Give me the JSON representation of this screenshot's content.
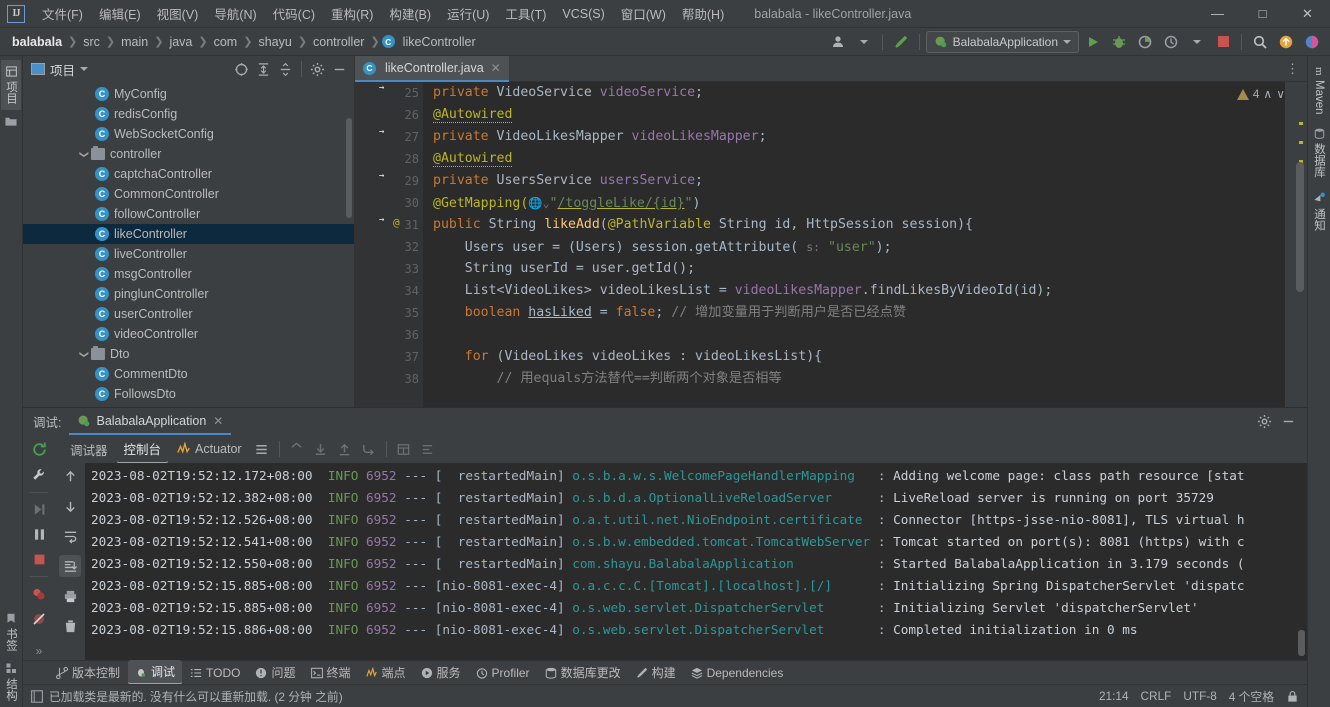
{
  "window": {
    "title": "balabala - likeController.java",
    "minimize_label": "—",
    "maximize_label": "□",
    "close_label": "✕"
  },
  "menu": [
    {
      "label": "文件(F)"
    },
    {
      "label": "编辑(E)"
    },
    {
      "label": "视图(V)"
    },
    {
      "label": "导航(N)"
    },
    {
      "label": "代码(C)"
    },
    {
      "label": "重构(R)"
    },
    {
      "label": "构建(B)"
    },
    {
      "label": "运行(U)"
    },
    {
      "label": "工具(T)"
    },
    {
      "label": "VCS(S)"
    },
    {
      "label": "窗口(W)"
    },
    {
      "label": "帮助(H)"
    }
  ],
  "breadcrumb": {
    "root": "balabala",
    "items": [
      "src",
      "main",
      "java",
      "com",
      "shayu",
      "controller"
    ],
    "file": "likeController",
    "file_icon": "C"
  },
  "toolbar": {
    "run_config": "BalabalaApplication",
    "run_label": "run-icon",
    "debug_label": "debug-icon",
    "stop_label": "stop-icon",
    "search_label": "search-icon"
  },
  "left_rail": [
    {
      "label": "项目",
      "icon": "project-icon",
      "active": true
    },
    {
      "label": "书签",
      "icon": "bookmark-icon",
      "active": false
    },
    {
      "label": "结构",
      "icon": "structure-icon",
      "active": false
    }
  ],
  "right_rail": [
    {
      "label": "Maven",
      "icon": "maven-icon"
    },
    {
      "label": "数据库",
      "icon": "database-icon"
    },
    {
      "label": "通知",
      "icon": "notification-icon"
    }
  ],
  "project_panel": {
    "title": "项目",
    "tree": [
      {
        "label": "MyConfig",
        "type": "class",
        "indent": 4,
        "selected": false
      },
      {
        "label": "redisConfig",
        "type": "class",
        "indent": 4,
        "selected": false
      },
      {
        "label": "WebSocketConfig",
        "type": "class",
        "indent": 4,
        "selected": false
      },
      {
        "label": "controller",
        "type": "package",
        "indent": 3,
        "selected": false,
        "expanded": true
      },
      {
        "label": "captchaController",
        "type": "class",
        "indent": 4,
        "selected": false
      },
      {
        "label": "CommonController",
        "type": "class",
        "indent": 4,
        "selected": false
      },
      {
        "label": "followController",
        "type": "class",
        "indent": 4,
        "selected": false
      },
      {
        "label": "likeController",
        "type": "class",
        "indent": 4,
        "selected": true
      },
      {
        "label": "liveController",
        "type": "class",
        "indent": 4,
        "selected": false
      },
      {
        "label": "msgController",
        "type": "class",
        "indent": 4,
        "selected": false
      },
      {
        "label": "pinglunController",
        "type": "class",
        "indent": 4,
        "selected": false
      },
      {
        "label": "userController",
        "type": "class",
        "indent": 4,
        "selected": false
      },
      {
        "label": "videoController",
        "type": "class",
        "indent": 4,
        "selected": false
      },
      {
        "label": "Dto",
        "type": "package",
        "indent": 3,
        "selected": false,
        "expanded": true
      },
      {
        "label": "CommentDto",
        "type": "class",
        "indent": 4,
        "selected": false
      },
      {
        "label": "FollowsDto",
        "type": "class",
        "indent": 4,
        "selected": false
      }
    ]
  },
  "editor": {
    "tab": {
      "label": "likeController.java",
      "icon": "C",
      "close": "✕"
    },
    "warning_count": "4",
    "lines": [
      {
        "n": "25",
        "marker": "bean"
      },
      {
        "n": "26",
        "marker": ""
      },
      {
        "n": "27",
        "marker": "bean"
      },
      {
        "n": "28",
        "marker": ""
      },
      {
        "n": "29",
        "marker": "bean"
      },
      {
        "n": "30",
        "marker": ""
      },
      {
        "n": "31",
        "marker": "bean-at",
        "fold": true
      },
      {
        "n": "32",
        "marker": ""
      },
      {
        "n": "33",
        "marker": ""
      },
      {
        "n": "34",
        "marker": ""
      },
      {
        "n": "35",
        "marker": ""
      },
      {
        "n": "36",
        "marker": ""
      },
      {
        "n": "37",
        "marker": "",
        "fold": true
      },
      {
        "n": "38",
        "marker": ""
      }
    ],
    "code": {
      "l25": "private VideoService videoService;",
      "l26": "@Autowired",
      "l27": "private VideoLikesMapper videoLikesMapper;",
      "l28": "@Autowired",
      "l29": "private UsersService usersService;",
      "l30_head": "@GetMapping(",
      "l30_path": "/toggleLike/{id}",
      "l31": "public String likeAdd(@PathVariable String id, HttpSession session){",
      "l32_a": "Users user = (Users) session.getAttribute(",
      "l32_hint": "s:",
      "l32_str": "\"user\"",
      "l32_b": ");",
      "l33": "String userId = user.getId();",
      "l34": "List<VideoLikes> videoLikesList = videoLikesMapper.findLikesByVideoId(id);",
      "l35_a": "boolean hasLiked = false; ",
      "l35_cmt": "// 增加变量用于判断用户是否已经点赞",
      "l37": "for (VideoLikes videoLikes : videoLikesList){",
      "l38_cmt": "// 用equals方法替代==判断两个对象是否相等"
    }
  },
  "debug_panel": {
    "label": "调试:",
    "session_tab": "BalabalaApplication",
    "session_close": "✕",
    "tabs": [
      {
        "label": "调试器",
        "active": false
      },
      {
        "label": "控制台",
        "active": true
      },
      {
        "label": "Actuator",
        "active": false,
        "icon": "actuator-icon"
      }
    ],
    "logs": [
      {
        "ts": "2023-08-02T19:52:12.172+08:00",
        "level": "INFO",
        "pid": "6952",
        "thread": "  restartedMain",
        "logger": "o.s.b.a.w.s.WelcomePageHandlerMapping",
        "msg": "Adding welcome page: class path resource [stat"
      },
      {
        "ts": "2023-08-02T19:52:12.382+08:00",
        "level": "INFO",
        "pid": "6952",
        "thread": "  restartedMain",
        "logger": "o.s.b.d.a.OptionalLiveReloadServer",
        "msg": "LiveReload server is running on port 35729"
      },
      {
        "ts": "2023-08-02T19:52:12.526+08:00",
        "level": "INFO",
        "pid": "6952",
        "thread": "  restartedMain",
        "logger": "o.a.t.util.net.NioEndpoint.certificate",
        "msg": "Connector [https-jsse-nio-8081], TLS virtual h"
      },
      {
        "ts": "2023-08-02T19:52:12.541+08:00",
        "level": "INFO",
        "pid": "6952",
        "thread": "  restartedMain",
        "logger": "o.s.b.w.embedded.tomcat.TomcatWebServer",
        "msg": "Tomcat started on port(s): 8081 (https) with c"
      },
      {
        "ts": "2023-08-02T19:52:12.550+08:00",
        "level": "INFO",
        "pid": "6952",
        "thread": "  restartedMain",
        "logger": "com.shayu.BalabalaApplication",
        "msg": "Started BalabalaApplication in 3.179 seconds ("
      },
      {
        "ts": "2023-08-02T19:52:15.885+08:00",
        "level": "INFO",
        "pid": "6952",
        "thread": "nio-8081-exec-4",
        "logger": "o.a.c.c.C.[Tomcat].[localhost].[/]",
        "msg": "Initializing Spring DispatcherServlet 'dispatc"
      },
      {
        "ts": "2023-08-02T19:52:15.885+08:00",
        "level": "INFO",
        "pid": "6952",
        "thread": "nio-8081-exec-4",
        "logger": "o.s.web.servlet.DispatcherServlet",
        "msg": "Initializing Servlet 'dispatcherServlet'"
      },
      {
        "ts": "2023-08-02T19:52:15.886+08:00",
        "level": "INFO",
        "pid": "6952",
        "thread": "nio-8081-exec-4",
        "logger": "o.s.web.servlet.DispatcherServlet",
        "msg": "Completed initialization in 0 ms"
      }
    ]
  },
  "tool_windows": [
    {
      "label": "版本控制",
      "icon": "vcs-icon",
      "active": false
    },
    {
      "label": "调试",
      "icon": "debug-icon",
      "active": true
    },
    {
      "label": "TODO",
      "icon": "todo-icon",
      "active": false
    },
    {
      "label": "问题",
      "icon": "problems-icon",
      "active": false
    },
    {
      "label": "终端",
      "icon": "terminal-icon",
      "active": false
    },
    {
      "label": "端点",
      "icon": "endpoints-icon",
      "active": false
    },
    {
      "label": "服务",
      "icon": "services-icon",
      "active": false
    },
    {
      "label": "Profiler",
      "icon": "profiler-icon",
      "active": false
    },
    {
      "label": "数据库更改",
      "icon": "db-changes-icon",
      "active": false
    },
    {
      "label": "构建",
      "icon": "build-icon",
      "active": false
    },
    {
      "label": "Dependencies",
      "icon": "dependencies-icon",
      "active": false
    }
  ],
  "status_bar": {
    "message": "已加载类是最新的. 没有什么可以重新加载. (2 分钟 之前)",
    "position": "21:14",
    "line_sep": "CRLF",
    "encoding": "UTF-8",
    "indent": "4 个空格",
    "lock": "lock-icon"
  },
  "colors": {
    "accent_blue": "#4a88c7",
    "selection": "#0d293e",
    "class_icon": "#3592c4",
    "run_green": "#5d9e4f",
    "stop_red": "#c75450",
    "editor_bg": "#2b2b2b",
    "panel_bg": "#3c3f41"
  }
}
